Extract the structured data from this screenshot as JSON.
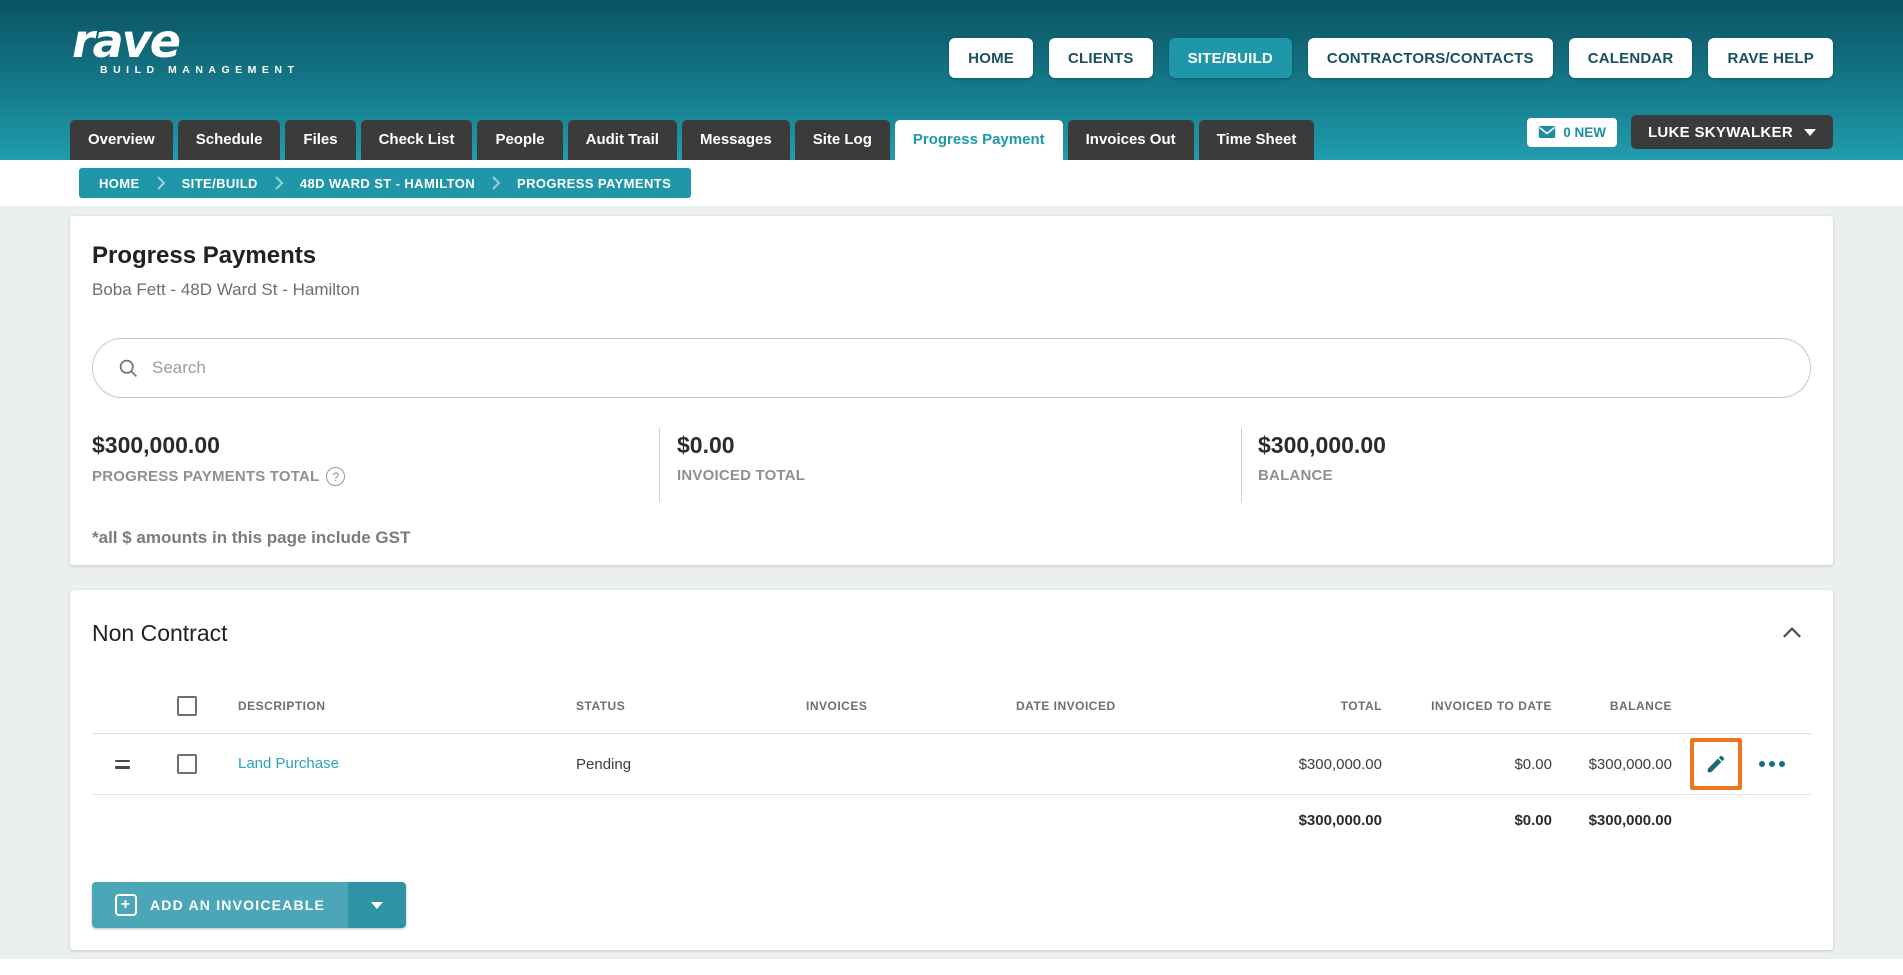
{
  "brand": {
    "name": "rave",
    "tagline": "BUILD MANAGEMENT"
  },
  "top_nav": {
    "items": [
      {
        "label": "HOME",
        "active": false
      },
      {
        "label": "CLIENTS",
        "active": false
      },
      {
        "label": "SITE/BUILD",
        "active": true
      },
      {
        "label": "CONTRACTORS/CONTACTS",
        "active": false
      },
      {
        "label": "CALENDAR",
        "active": false
      },
      {
        "label": "RAVE HELP",
        "active": false
      }
    ]
  },
  "tab_nav": {
    "items": [
      {
        "label": "Overview",
        "active": false
      },
      {
        "label": "Schedule",
        "active": false
      },
      {
        "label": "Files",
        "active": false
      },
      {
        "label": "Check List",
        "active": false
      },
      {
        "label": "People",
        "active": false
      },
      {
        "label": "Audit Trail",
        "active": false
      },
      {
        "label": "Messages",
        "active": false
      },
      {
        "label": "Site Log",
        "active": false
      },
      {
        "label": "Progress Payment",
        "active": true
      },
      {
        "label": "Invoices Out",
        "active": false
      },
      {
        "label": "Time Sheet",
        "active": false
      }
    ],
    "messages_badge": "0 NEW",
    "user_label": "LUKE SKYWALKER"
  },
  "breadcrumb": {
    "items": [
      "HOME",
      "SITE/BUILD",
      "48D WARD ST - HAMILTON",
      "PROGRESS PAYMENTS"
    ]
  },
  "summary": {
    "title": "Progress Payments",
    "subtitle": "Boba Fett - 48D Ward St - Hamilton",
    "search_placeholder": "Search",
    "stats": [
      {
        "value": "$300,000.00",
        "label": "PROGRESS PAYMENTS TOTAL",
        "has_help_icon": true
      },
      {
        "value": "$0.00",
        "label": "INVOICED TOTAL",
        "has_help_icon": false
      },
      {
        "value": "$300,000.00",
        "label": "BALANCE",
        "has_help_icon": false
      }
    ],
    "gst_note": "*all $ amounts in this page include GST"
  },
  "section": {
    "title": "Non Contract",
    "columns": [
      "DESCRIPTION",
      "STATUS",
      "INVOICES",
      "DATE INVOICED",
      "TOTAL",
      "INVOICED TO DATE",
      "BALANCE"
    ],
    "rows": [
      {
        "description": "Land Purchase",
        "status": "Pending",
        "invoices": "",
        "date_invoiced": "",
        "total": "$300,000.00",
        "invoiced_to_date": "$0.00",
        "balance": "$300,000.00"
      }
    ],
    "totals": {
      "total": "$300,000.00",
      "invoiced_to_date": "$0.00",
      "balance": "$300,000.00"
    },
    "add_button_label": "ADD AN INVOICEABLE"
  },
  "colors": {
    "accent_teal": "#1f97a9",
    "header_gradient_top": "#0b5362",
    "header_gradient_bottom": "#219dae",
    "tab_dark": "#3b3b3b",
    "link_teal": "#2aa2b8",
    "highlight_orange": "#f0741f",
    "action_icon_teal": "#16708b"
  }
}
